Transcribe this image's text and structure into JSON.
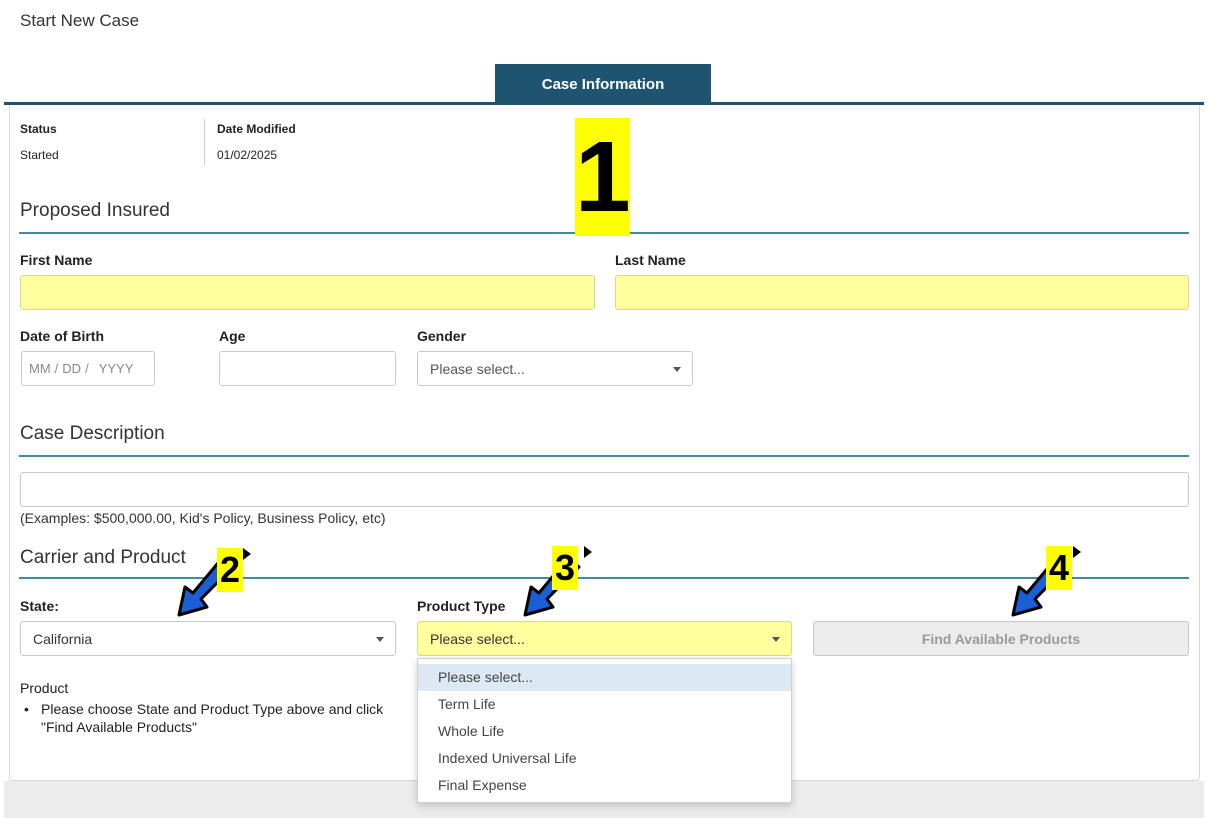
{
  "page_title": "Start New Case",
  "tab_label": "Case Information",
  "status": {
    "label": "Status",
    "value": "Started"
  },
  "date_modified": {
    "label": "Date Modified",
    "value": "01/02/2025"
  },
  "sections": {
    "proposed_insured": "Proposed Insured",
    "case_description": "Case Description",
    "carrier_product": "Carrier and Product"
  },
  "fields": {
    "first_name_label": "First Name",
    "last_name_label": "Last Name",
    "dob_label": "Date of Birth",
    "dob_mm": "MM",
    "dob_dd": "DD",
    "dob_yyyy": "YYYY",
    "dob_sep": "/",
    "age_label": "Age",
    "gender_label": "Gender",
    "gender_value": "Please select...",
    "case_description_helper": "(Examples: $500,000.00, Kid's Policy, Business Policy, etc)",
    "state_label": "State:",
    "state_value": "California",
    "product_type_label": "Product Type",
    "product_type_value": "Please select..."
  },
  "find_button": "Find Available Products",
  "product": {
    "label": "Product",
    "hint": "Please choose State and Product Type above and click \"Find Available Products\""
  },
  "product_type_options": [
    "Please select...",
    "Term Life",
    "Whole Life",
    "Indexed Universal Life",
    "Final Expense"
  ],
  "annotations": [
    "1",
    "2",
    "3",
    "4"
  ],
  "colors": {
    "tab": "#1f5470",
    "section_rule": "#3d8ca3",
    "required_field": "#ffff9e",
    "annotation_badge": "#ffff00",
    "annotation_arrow": "#1a5fd6"
  }
}
